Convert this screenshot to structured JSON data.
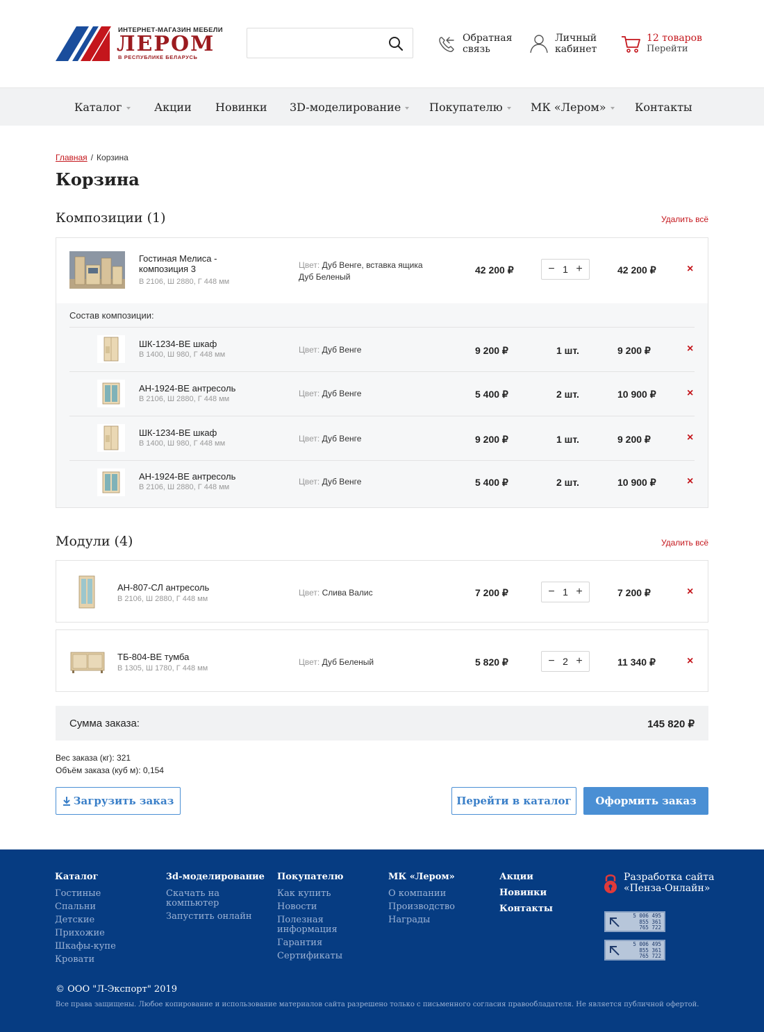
{
  "header": {
    "logo_top": "ИНТЕРНЕТ-МАГАЗИН МЕБЕЛИ",
    "logo_main": "ЛЕРОМ",
    "logo_bottom": "В РЕСПУБЛИКЕ БЕЛАРУСЬ",
    "search_placeholder": "",
    "callback_line1": "Обратная",
    "callback_line2": "связь",
    "account_line1": "Личный",
    "account_line2": "кабинет",
    "cart_count": "12 товаров",
    "cart_link": "Перейти"
  },
  "nav": [
    "Каталог",
    "Акции",
    "Новинки",
    "3D-моделирование",
    "Покупателю",
    "МК «Лером»",
    "Контакты"
  ],
  "breadcrumb": {
    "home": "Главная",
    "sep": "/",
    "current": "Корзина"
  },
  "page_title": "Корзина",
  "compositions": {
    "title": "Композиции (1)",
    "delete_all": "Удалить всё",
    "main": {
      "name_line1": "Гостиная Мелиса -",
      "name_line2": "композиция 3",
      "dims": "В 2106, Ш 2880, Г 448 мм",
      "color_label": "Цвет:",
      "color_line1": "Дуб Венге, вставка ящика",
      "color_line2": "Дуб Беленый",
      "price": "42 200 ₽",
      "qty": "1",
      "total": "42 200 ₽",
      "remove": "×"
    },
    "composition_label": "Состав композиции:",
    "items": [
      {
        "name": "ШК-1234-ВЕ шкаф",
        "dims": "В 1400, Ш 980, Г 448 мм",
        "color_label": "Цвет:",
        "color": "Дуб Венге",
        "price": "9 200 ₽",
        "qty": "1 шт.",
        "total": "9 200 ₽",
        "remove": "×"
      },
      {
        "name": "АН-1924-ВЕ антресоль",
        "dims": "В 2106, Ш 2880, Г 448 мм",
        "color_label": "Цвет:",
        "color": "Дуб Венге",
        "price": "5 400 ₽",
        "qty": "2 шт.",
        "total": "10 900 ₽",
        "remove": "×"
      },
      {
        "name": "ШК-1234-ВЕ шкаф",
        "dims": "В 1400, Ш 980, Г 448 мм",
        "color_label": "Цвет:",
        "color": "Дуб Венге",
        "price": "9 200 ₽",
        "qty": "1 шт.",
        "total": "9 200 ₽",
        "remove": "×"
      },
      {
        "name": "АН-1924-ВЕ антресоль",
        "dims": "В 2106, Ш 2880, Г 448 мм",
        "color_label": "Цвет:",
        "color": "Дуб Венге",
        "price": "5 400 ₽",
        "qty": "2 шт.",
        "total": "10 900 ₽",
        "remove": "×"
      }
    ]
  },
  "modules": {
    "title": "Модули (4)",
    "delete_all": "Удалить всё",
    "items": [
      {
        "name": "АН-807-СЛ антресоль",
        "dims": "В 2106, Ш 2880, Г 448 мм",
        "color_label": "Цвет:",
        "color": "Слива Валис",
        "price": "7 200 ₽",
        "qty": "1",
        "total": "7 200 ₽",
        "remove": "×"
      },
      {
        "name": "ТБ-804-ВЕ тумба",
        "dims": "В 1305, Ш 1780, Г 448 мм",
        "color_label": "Цвет:",
        "color": "Дуб Беленый",
        "price": "5 820 ₽",
        "qty": "2",
        "total": "11 340 ₽",
        "remove": "×"
      }
    ]
  },
  "summary": {
    "label": "Сумма заказа:",
    "value": "145 820 ₽",
    "weight": "Вес заказа (кг): 321",
    "volume": "Объём заказа (куб м): 0,154"
  },
  "buttons": {
    "upload": "Загрузить заказ",
    "catalog": "Перейти в каталог",
    "checkout": "Оформить заказ"
  },
  "footer": {
    "cols": [
      {
        "head": "Каталог",
        "links": [
          "Гостиные",
          "Спальни",
          "Детские",
          "Прихожие",
          "Шкафы-купе",
          "Кровати"
        ]
      },
      {
        "head": "3d-моделирование",
        "links": [
          "Скачать на компьютер",
          "Запустить онлайн"
        ]
      },
      {
        "head": "Покупателю",
        "links": [
          "Как купить",
          "Новости",
          "Полезная информация",
          "Гарантия",
          "Сертификаты"
        ]
      },
      {
        "head": "МК «Лером»",
        "links": [
          "О компании",
          "Производство",
          "Награды"
        ]
      }
    ],
    "extra_links": [
      "Акции",
      "Новинки",
      "Контакты"
    ],
    "dev_line1": "Разработка сайта",
    "dev_line2": "«Пенза-Онлайн»",
    "counter_nums": [
      "5 006 495",
      "855 361",
      "765 722"
    ],
    "copyright": "©  ООО \"Л-Экспорт\" 2019",
    "legal": "Все права защищены. Любое копирование и использование материалов сайта разрешено только с письменного согласия правообладателя. Не является публичной офертой."
  },
  "colors": {
    "brand_red": "#9b1b1f",
    "accent_red": "#c4161c",
    "blue": "#4a8fd4",
    "footer_blue": "#063c82"
  }
}
